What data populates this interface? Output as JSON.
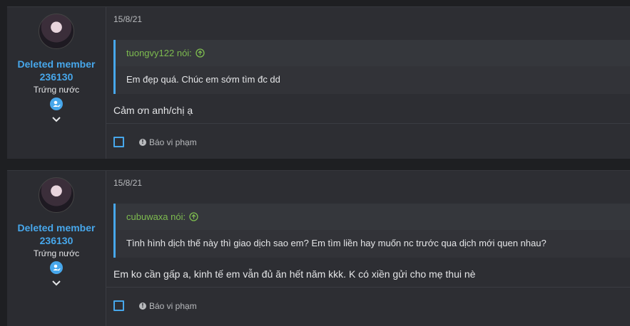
{
  "posts": [
    {
      "author": {
        "name": "Deleted member 236130",
        "title": "Trứng nước"
      },
      "date": "15/8/21",
      "quote": {
        "author_said": "tuongvy122 nói:",
        "text": "Em đẹp quá. Chúc em sớm tìm đc dd"
      },
      "message": "Cảm ơn anh/chị ạ",
      "report_label": "Báo vi phạm"
    },
    {
      "author": {
        "name": "Deleted member 236130",
        "title": "Trứng nước"
      },
      "date": "15/8/21",
      "quote": {
        "author_said": "cubuwaxa nói:",
        "text": "Tình hình dịch thế này thì giao dịch sao em? Em tìm liền hay muốn nc trước qua dịch mới quen nhau?"
      },
      "message": "Em ko cần gấp a, kinh tế em vẫn đủ ăn hết năm kkk. K có xiền gửi cho mẹ thui nè",
      "report_label": "Báo vi phạm"
    }
  ],
  "colors": {
    "accent": "#47a7eb",
    "quote_author": "#7dbb4f",
    "background": "#1e1f22"
  }
}
